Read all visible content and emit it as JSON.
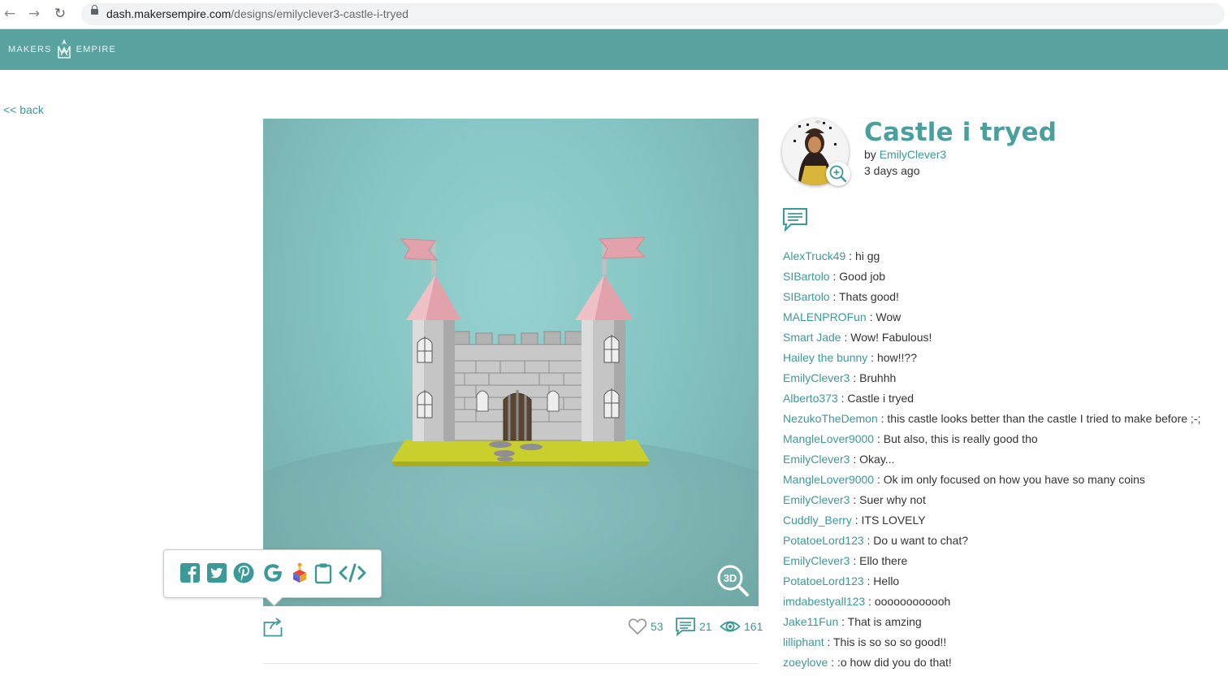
{
  "browser": {
    "url_host": "dash.makersempire.com",
    "url_path": "/designs/emilyclever3-castle-i-tryed"
  },
  "header": {
    "logo_left": "MAKERS",
    "logo_right": "EMPIRE"
  },
  "nav": {
    "back_label": "<< back"
  },
  "design": {
    "title": "Castle i tryed",
    "by_label": "by",
    "author": "EmilyClever3",
    "posted": "3 days ago"
  },
  "viewer": {
    "mode_label": "3D"
  },
  "share_menu": {
    "items": [
      "facebook-icon",
      "twitter-icon",
      "pinterest-icon",
      "google-classroom-icon",
      "seesaw-icon",
      "clipboard-icon",
      "embed-code-icon"
    ]
  },
  "stats": {
    "likes": "53",
    "comments": "21",
    "views": "161"
  },
  "colors": {
    "brand": "#5ba3a0",
    "link": "#3b9a98",
    "title": "#4aa09d"
  },
  "comments": [
    {
      "user": "AlexTruck49",
      "text": " : hi gg"
    },
    {
      "user": "SIBartolo",
      "text": " : Good job"
    },
    {
      "user": "SIBartolo",
      "text": " : Thats good!"
    },
    {
      "user": "MALENPROFun",
      "text": " : Wow"
    },
    {
      "user": "Smart Jade",
      "text": " : Wow! Fabulous!"
    },
    {
      "user": "Hailey the bunny",
      "text": " : how!!??"
    },
    {
      "user": "EmilyClever3",
      "text": " : Bruhhh"
    },
    {
      "user": "Alberto373",
      "text": " : Castle i tryed"
    },
    {
      "user": "NezukoTheDemon",
      "text": " : this castle looks better than the castle I tried to make before ;-;"
    },
    {
      "user": "MangleLover9000",
      "text": " : But also, this is really good tho"
    },
    {
      "user": "EmilyClever3",
      "text": " : Okay..."
    },
    {
      "user": "MangleLover9000",
      "text": " : Ok im only focused on how you have so many coins"
    },
    {
      "user": "EmilyClever3",
      "text": " : Suer why not"
    },
    {
      "user": "Cuddly_Berry",
      "text": " : ITS LOVELY"
    },
    {
      "user": "PotatoeLord123",
      "text": " : Do u want to chat?"
    },
    {
      "user": "EmilyClever3",
      "text": " : Ello there"
    },
    {
      "user": "PotatoeLord123",
      "text": " : Hello"
    },
    {
      "user": "imdabestyall123",
      "text": " : oooooooooooh"
    },
    {
      "user": "Jake11Fun",
      "text": " : That is amzing"
    },
    {
      "user": "lilliphant",
      "text": " : This is so so so good!!"
    },
    {
      "user": "zoeylove",
      "text": " : :o how did you do that!"
    }
  ]
}
